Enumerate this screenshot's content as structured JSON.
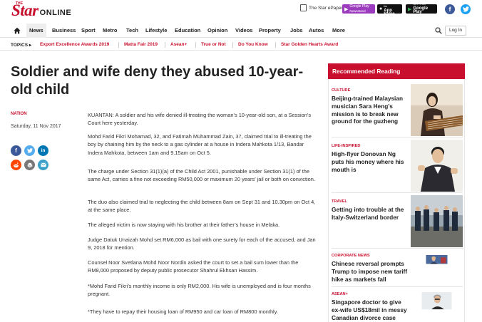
{
  "header": {
    "logo_the": "THE",
    "logo_star": "Star",
    "logo_online": "ONLINE",
    "epaper_label": "The Star ePaper",
    "store_google_top": "GET IT ON",
    "store_google_bottom": "Google Play",
    "store_google_sub": "Newsstand",
    "store_apple_top": "Download on the",
    "store_apple_bottom": "App Store",
    "store_gp2_top": "GET IT ON",
    "store_gp2_bottom": "Google Play",
    "facebook_icon": "facebook-icon",
    "twitter_icon": "twitter-icon"
  },
  "nav": {
    "items": [
      "News",
      "Business",
      "Sport",
      "Metro",
      "Tech",
      "Lifestyle",
      "Education",
      "Opinion",
      "Videos",
      "Property",
      "Jobs",
      "Autos",
      "More"
    ],
    "active": "News",
    "login_label": "Log In"
  },
  "topics": {
    "label": "TOPICS",
    "items": [
      "Export Excellence Awards 2019",
      "Matta Fair 2019",
      "Asean+",
      "True or Not",
      "Do You Know",
      "Star Golden Hearts Award"
    ]
  },
  "article": {
    "headline": "Soldier and wife deny they abused 10-year-old child",
    "section": "NATION",
    "date": "Saturday, 11 Nov 2017",
    "paragraphs": [
      "KUANTAN: A soldier and his wife denied ill-treating the woman’s 10-year-old son, at a Session’s Court here yesterday.",
      "Mohd Farid Fikri Mohamad, 32, and Fatimah Muhammad Zain, 37, claimed trial to ill-treating the boy by chaining him by the neck to a gas cylinder at a house in Indera Mahkota 1/13, Bandar Indera Mahkota, between 1am and 9.15am on Oct 5.",
      "The charge under Section 31(1)(a) of the Child Act 2001, punishable under Section 31(1) of the same Act, carries a fine not exceeding RM50,000 or maximum 20 years’ jail or both on conviction.",
      "The duo also claimed trial to neglecting the child between 8am on Sept 31 and 10.30pm on Oct 4, at the same place.",
      "The alleged victim is now staying with his brother at their father’s house in Melaka.",
      "Judge Datuk Unaizah Mohd set RM6,000 as bail with one surety for each of the accused, and Jan 9, 2018 for mention.",
      "Counsel Noor Svetlana Mohd Noor Nordin asked the court to set a bail sum lower than the RM8,000 proposed by deputy public prosecutor Shahrul Ekhsan Hassim.",
      "*Mohd Farid Fikri’s monthly income is only RM2,000. His wife is unemployed and is four months pregnant.",
      "*They have to repay their housing loan of RM950 and car loan of RM800 monthly."
    ]
  },
  "sidebar": {
    "title": "Recommended Reading",
    "items": [
      {
        "category": "CULTURE",
        "title": "Beijing-trained Malaysian musician Sara Heng’s mission is to break new ground for the guzheng"
      },
      {
        "category": "LIFE-INSPIRED",
        "title": "High-flyer Donovan Ng puts his money where his mouth is"
      },
      {
        "category": "TRAVEL",
        "title": "Getting into trouble at the Italy-Switzerland border"
      },
      {
        "category": "CORPORATE NEWS",
        "title": "Chinese reversal prompts Trump to impose new tariff hike as markets fall"
      },
      {
        "category": "ASEAN+",
        "title": "Singapore doctor to give ex-wife US$18mil in messy Canadian divorce case"
      }
    ]
  },
  "colors": {
    "brand_red": "#c8102e",
    "facebook": "#3b5998",
    "twitter": "#1da1f2"
  }
}
